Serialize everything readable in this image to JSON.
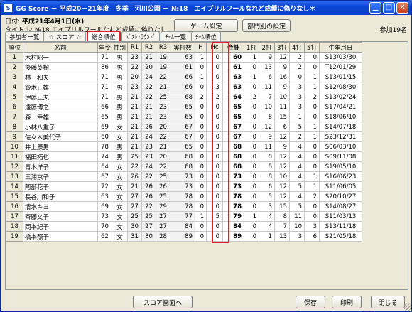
{
  "window": {
    "title": "GG Score － 平成20－21年度　冬季　河川公園 － №18　エイプリルフールなれど成績に偽りなし＊",
    "app_icon": "S"
  },
  "info": {
    "date_label": "日付:",
    "date_value": "平成21年4月1日(水)",
    "subtitle": "タイトル: №18 エイプリルフールなれど成績に偽りなし",
    "participants": "参加19名"
  },
  "buttons": {
    "game_settings": "ゲーム設定",
    "dept_settings": "部門別の設定",
    "score_screen": "スコア画面へ",
    "save": "保存",
    "print": "印刷",
    "close": "閉じる"
  },
  "tabs": [
    {
      "label": "参加者一覧",
      "active": false
    },
    {
      "label": "☆ スコア ☆",
      "active": false
    },
    {
      "label": "総合順位",
      "active": true
    },
    {
      "label": "ﾍﾞｽﾄ･ﾗｳﾝﾄﾞ",
      "active": false
    },
    {
      "label": "ﾁｰﾑ一覧",
      "active": false
    },
    {
      "label": "ﾁｰﾑ順位",
      "active": false
    }
  ],
  "table": {
    "headers": [
      "順位",
      "名前",
      "年令",
      "性別",
      "R1",
      "R2",
      "R3",
      "実打数",
      "H",
      "Hc",
      "合計",
      "1打",
      "2打",
      "3打",
      "4打",
      "5打",
      "生年月日"
    ],
    "rows": [
      [
        "1",
        "木村昭一",
        "71",
        "男",
        "23",
        "21",
        "19",
        "63",
        "1",
        "0",
        "60",
        "1",
        "9",
        "12",
        "2",
        "0",
        "S13/03/30"
      ],
      [
        "2",
        "後藤英樹",
        "86",
        "男",
        "22",
        "20",
        "19",
        "61",
        "0",
        "0",
        "61",
        "0",
        "13",
        "9",
        "2",
        "0",
        "T12/01/29"
      ],
      [
        "3",
        "林　和夫",
        "71",
        "男",
        "20",
        "24",
        "22",
        "66",
        "1",
        "0",
        "63",
        "1",
        "6",
        "16",
        "0",
        "1",
        "S13/01/15"
      ],
      [
        "4",
        "鈴木正雄",
        "71",
        "男",
        "23",
        "22",
        "21",
        "66",
        "0",
        "-3",
        "63",
        "0",
        "11",
        "9",
        "3",
        "1",
        "S12/08/30"
      ],
      [
        "5",
        "伊藤正夫",
        "71",
        "男",
        "21",
        "22",
        "25",
        "68",
        "2",
        "2",
        "64",
        "2",
        "7",
        "10",
        "3",
        "2",
        "S13/02/24"
      ],
      [
        "6",
        "遠藤博之",
        "66",
        "男",
        "21",
        "21",
        "23",
        "65",
        "0",
        "0",
        "65",
        "0",
        "10",
        "11",
        "3",
        "0",
        "S17/04/21"
      ],
      [
        "7",
        "森　幸雄",
        "65",
        "男",
        "21",
        "21",
        "23",
        "65",
        "0",
        "0",
        "65",
        "0",
        "8",
        "15",
        "1",
        "0",
        "S18/06/10"
      ],
      [
        "8",
        "小林八重子",
        "69",
        "女",
        "21",
        "26",
        "20",
        "67",
        "0",
        "0",
        "67",
        "0",
        "12",
        "6",
        "5",
        "1",
        "S14/07/18"
      ],
      [
        "9",
        "佐々木美代子",
        "60",
        "女",
        "21",
        "24",
        "22",
        "67",
        "0",
        "0",
        "67",
        "0",
        "9",
        "12",
        "2",
        "1",
        "S23/12/31"
      ],
      [
        "10",
        "井上辰男",
        "78",
        "男",
        "21",
        "23",
        "21",
        "65",
        "0",
        "3",
        "68",
        "0",
        "11",
        "9",
        "4",
        "0",
        "S06/03/10"
      ],
      [
        "11",
        "福田拓也",
        "74",
        "男",
        "25",
        "23",
        "20",
        "68",
        "0",
        "0",
        "68",
        "0",
        "8",
        "12",
        "4",
        "0",
        "S09/11/08"
      ],
      [
        "12",
        "青木洋子",
        "64",
        "女",
        "22",
        "24",
        "22",
        "68",
        "0",
        "0",
        "68",
        "0",
        "8",
        "12",
        "4",
        "0",
        "S19/05/10"
      ],
      [
        "13",
        "三浦京子",
        "67",
        "女",
        "26",
        "22",
        "25",
        "73",
        "0",
        "0",
        "73",
        "0",
        "8",
        "10",
        "4",
        "1",
        "S16/06/23"
      ],
      [
        "14",
        "阿部花子",
        "72",
        "女",
        "21",
        "26",
        "26",
        "73",
        "0",
        "0",
        "73",
        "0",
        "6",
        "12",
        "5",
        "1",
        "S11/06/05"
      ],
      [
        "15",
        "長谷川和子",
        "63",
        "女",
        "27",
        "26",
        "25",
        "78",
        "0",
        "0",
        "78",
        "0",
        "5",
        "12",
        "4",
        "2",
        "S20/10/27"
      ],
      [
        "16",
        "清水キヨ",
        "69",
        "女",
        "27",
        "22",
        "29",
        "78",
        "0",
        "0",
        "78",
        "0",
        "3",
        "15",
        "5",
        "0",
        "S14/08/27"
      ],
      [
        "17",
        "斉藤文子",
        "73",
        "女",
        "25",
        "25",
        "27",
        "77",
        "1",
        "5",
        "79",
        "1",
        "4",
        "8",
        "11",
        "0",
        "S11/03/13"
      ],
      [
        "18",
        "岡本紀子",
        "70",
        "女",
        "30",
        "27",
        "27",
        "84",
        "0",
        "0",
        "84",
        "0",
        "4",
        "7",
        "10",
        "3",
        "S13/11/18"
      ],
      [
        "19",
        "橋本照子",
        "62",
        "女",
        "31",
        "30",
        "28",
        "89",
        "0",
        "0",
        "89",
        "0",
        "1",
        "13",
        "3",
        "6",
        "S21/05/18"
      ]
    ]
  }
}
